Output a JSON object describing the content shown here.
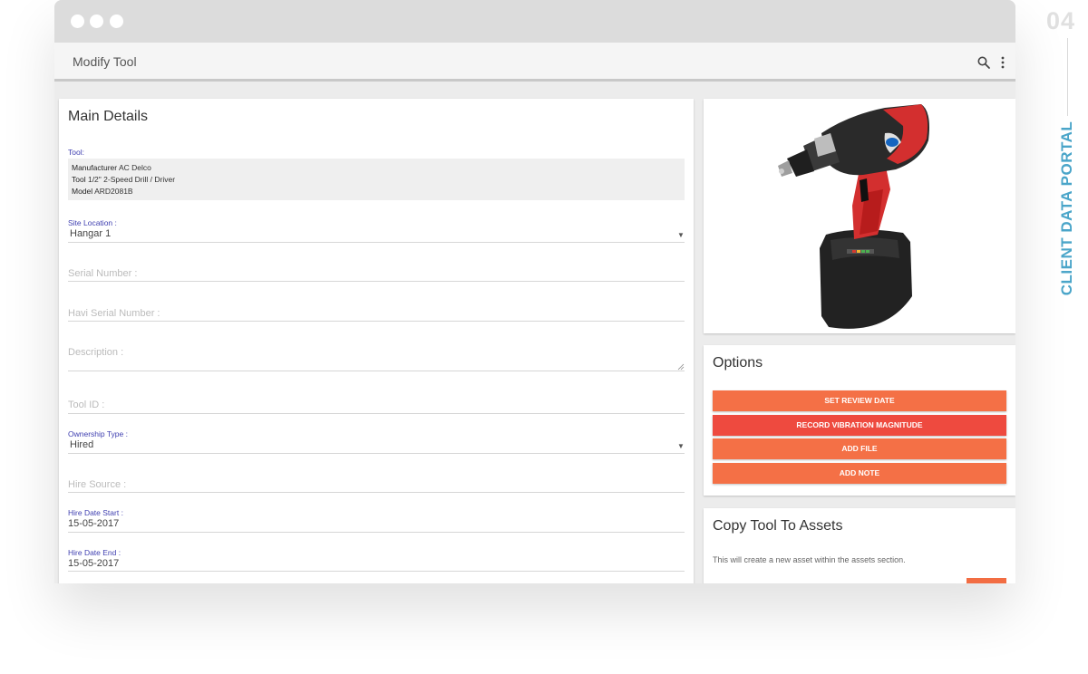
{
  "side_brand": {
    "page_number": "04",
    "label": "CLIENT DATA PORTAL"
  },
  "appbar": {
    "title": "Modify Tool",
    "icons": [
      "search-icon",
      "more-vertical-icon"
    ]
  },
  "main_details": {
    "title": "Main Details",
    "tool_label": "Tool:",
    "tool_info": [
      {
        "key": "Manufacturer",
        "value": "AC Delco"
      },
      {
        "key": "Tool",
        "value": "1/2\" 2-Speed Drill / Driver"
      },
      {
        "key": "Model",
        "value": "ARD2081B"
      }
    ],
    "site_location": {
      "label": "Site Location :",
      "value": "Hangar 1"
    },
    "serial_number": {
      "placeholder": "Serial Number :"
    },
    "havi_serial_number": {
      "placeholder": "Havi Serial Number :"
    },
    "description": {
      "placeholder": "Description :"
    },
    "tool_id": {
      "placeholder": "Tool ID :"
    },
    "ownership_type": {
      "label": "Ownership Type :",
      "value": "Hired"
    },
    "hire_source": {
      "placeholder": "Hire Source :"
    },
    "hire_date_start": {
      "label": "Hire Date Start :",
      "value": "15-05-2017"
    },
    "hire_date_end": {
      "label": "Hire Date End :",
      "value": "15-05-2017"
    }
  },
  "options": {
    "title": "Options",
    "buttons": [
      {
        "label": "SET REVIEW DATE",
        "color": "#f47046"
      },
      {
        "label": "RECORD VIBRATION MAGNITUDE",
        "color": "#ee4a3f"
      },
      {
        "label": "ADD FILE",
        "color": "#f47046"
      },
      {
        "label": "ADD NOTE",
        "color": "#f47046"
      }
    ]
  },
  "copy_tool": {
    "title": "Copy Tool To Assets",
    "description": "This will create a new asset within the assets section."
  },
  "colors": {
    "accent_orange": "#f47046",
    "accent_red": "#ee4a3f",
    "label_blue": "#3f3fb0",
    "brand_blue": "#4aa5c9"
  }
}
